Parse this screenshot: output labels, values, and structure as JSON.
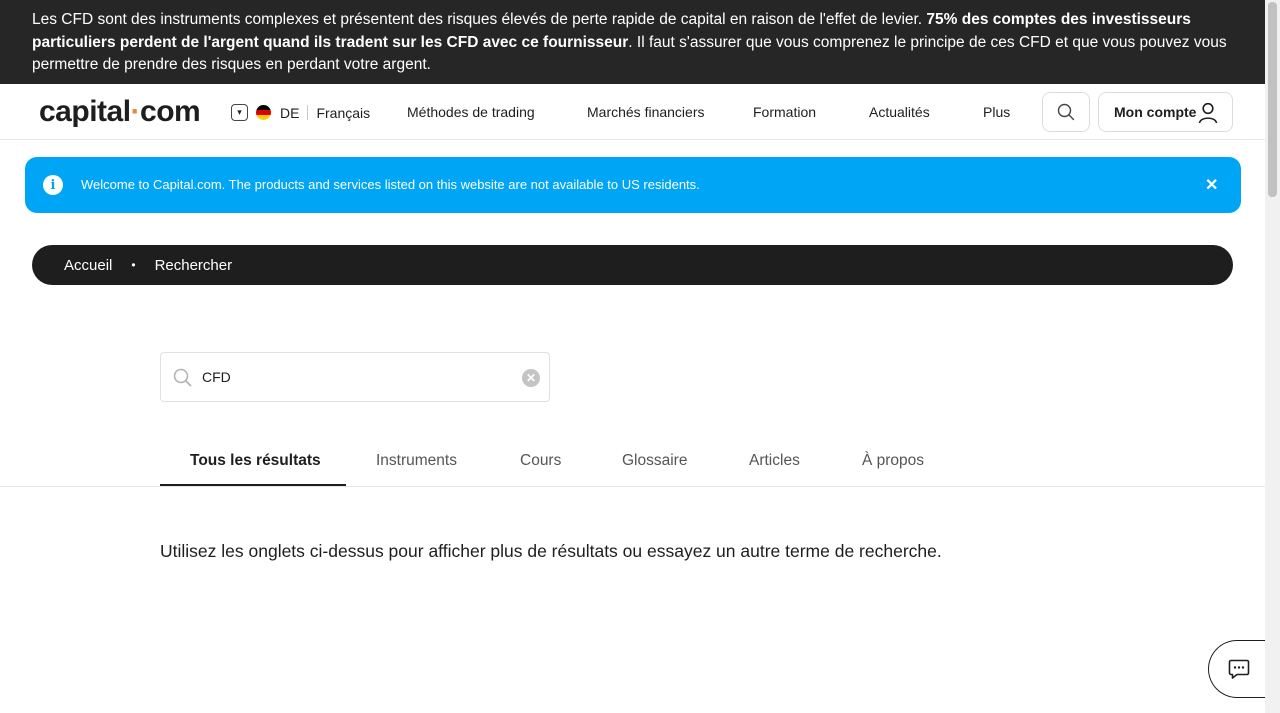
{
  "risk_banner": {
    "text_before": "Les CFD sont des instruments complexes et présentent des risques élevés de perte rapide de capital en raison de l'effet de levier. ",
    "text_bold": "75% des comptes des investisseurs particuliers perdent de l'argent quand ils tradent sur les CFD avec ce fournisseur",
    "text_after": ". Il faut s'assurer que vous comprenez le principe de ces CFD et que vous pouvez vous permettre de prendre des risques en perdant votre argent."
  },
  "header": {
    "logo_part1": "capital",
    "logo_dot": "·",
    "logo_part2": "com",
    "country": "DE",
    "language": "Français",
    "nav": [
      "Méthodes de trading",
      "Marchés financiers",
      "Formation",
      "Actualités",
      "Plus"
    ],
    "account_label": "Mon compte",
    "search_icon": "search-icon",
    "account_icon": "user-icon"
  },
  "alert": {
    "message": "Welcome to Capital.com. The products and services listed on this website are not available to US residents.",
    "info_glyph": "i",
    "close_glyph": "✕",
    "color": "#00a5f5"
  },
  "breadcrumb": {
    "home": "Accueil",
    "separator": "•",
    "current": "Rechercher"
  },
  "search": {
    "value": "CFD",
    "clear_glyph": "✕"
  },
  "tabs": [
    "Tous les résultats",
    "Instruments",
    "Cours",
    "Glossaire",
    "Articles",
    "À propos"
  ],
  "active_tab": "Tous les résultats",
  "hint_text": "Utilisez les onglets ci-dessus pour afficher plus de résultats ou essayez un autre terme de recherche.",
  "chat_icon": "chat-icon"
}
